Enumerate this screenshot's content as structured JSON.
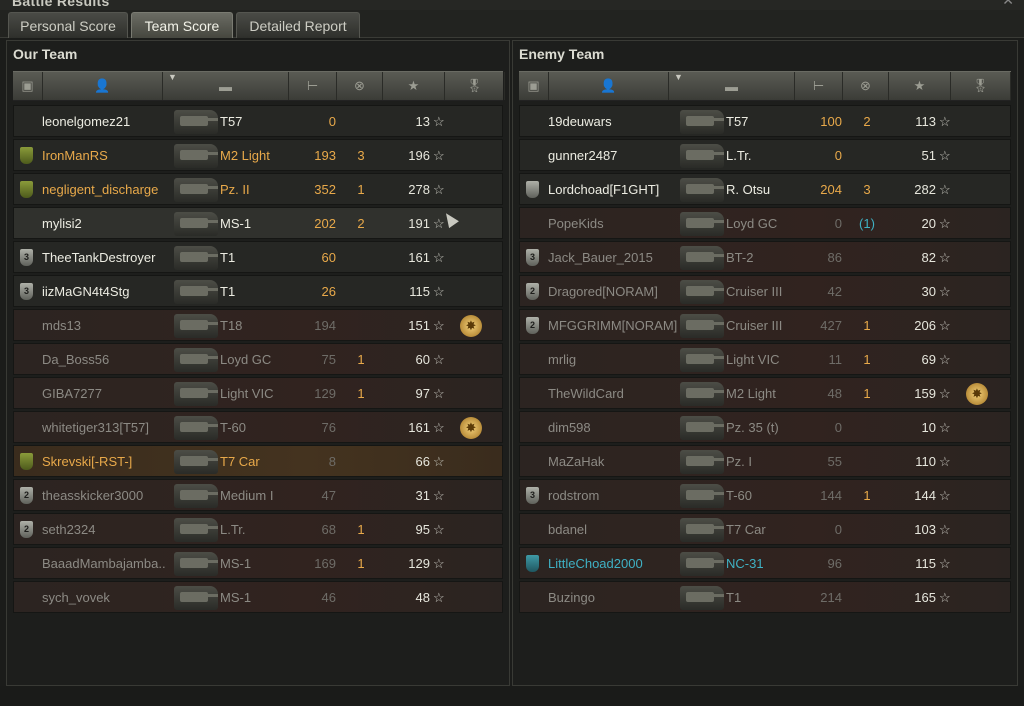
{
  "window": {
    "title": "Battle Results",
    "close_icon": "close-icon"
  },
  "tabs": [
    {
      "label": "Personal Score",
      "active": false
    },
    {
      "label": "Team Score",
      "active": true
    },
    {
      "label": "Detailed Report",
      "active": false
    }
  ],
  "columns": {
    "icons": [
      "platoon-icon",
      "player-icon",
      "tank-icon",
      "damage-icon",
      "kills-icon",
      "xp-icon",
      "medal-icon"
    ],
    "sort_icon": "sort-arrow-icon"
  },
  "our_team": {
    "title": "Our Team",
    "rows": [
      {
        "badge": "",
        "player": "leonelgomez21",
        "tank": "T57",
        "damage": "0",
        "kills": "",
        "xp": "13",
        "medal": false,
        "name_color": "white",
        "dmg_color": "orange",
        "state": "alive"
      },
      {
        "badge": "gold",
        "player": "IronManRS",
        "tank": "M2 Light",
        "damage": "193",
        "kills": "3",
        "xp": "196",
        "medal": false,
        "name_color": "orange",
        "dmg_color": "orange",
        "state": "alive"
      },
      {
        "badge": "gold",
        "player": "negligent_discharge",
        "tank": "Pz. II",
        "damage": "352",
        "kills": "1",
        "xp": "278",
        "medal": false,
        "name_color": "orange",
        "dmg_color": "orange",
        "state": "alive"
      },
      {
        "badge": "",
        "player": "mylisi2",
        "tank": "MS-1",
        "damage": "202",
        "kills": "2",
        "xp": "191",
        "medal": false,
        "name_color": "white",
        "dmg_color": "orange",
        "state": "hl"
      },
      {
        "badge": "3",
        "player": "TheeTankDestroyer",
        "tank": "T1",
        "damage": "60",
        "kills": "",
        "xp": "161",
        "medal": false,
        "name_color": "white",
        "dmg_color": "orange",
        "state": "alive"
      },
      {
        "badge": "3",
        "player": "iizMaGN4t4Stg",
        "tank": "T1",
        "damage": "26",
        "kills": "",
        "xp": "115",
        "medal": false,
        "name_color": "white",
        "dmg_color": "orange",
        "state": "alive"
      },
      {
        "badge": "",
        "player": "mds13",
        "tank": "T18",
        "damage": "194",
        "kills": "",
        "xp": "151",
        "medal": true,
        "name_color": "grey",
        "dmg_color": "grey",
        "state": "dead"
      },
      {
        "badge": "",
        "player": "Da_Boss56",
        "tank": "Loyd GC",
        "damage": "75",
        "kills": "1",
        "xp": "60",
        "medal": false,
        "name_color": "grey",
        "dmg_color": "grey",
        "state": "dead"
      },
      {
        "badge": "",
        "player": "GIBA7277",
        "tank": "Light VIC",
        "damage": "129",
        "kills": "1",
        "xp": "97",
        "medal": false,
        "name_color": "grey",
        "dmg_color": "grey",
        "state": "dead"
      },
      {
        "badge": "",
        "player": "whitetiger313[T57]",
        "tank": "T-60",
        "damage": "76",
        "kills": "",
        "xp": "161",
        "medal": true,
        "name_color": "grey",
        "dmg_color": "grey",
        "state": "dead"
      },
      {
        "badge": "gold",
        "player": "Skrevski[-RST-]",
        "tank": "T7 Car",
        "damage": "8",
        "kills": "",
        "xp": "66",
        "medal": false,
        "name_color": "orange",
        "dmg_color": "grey",
        "state": "plat"
      },
      {
        "badge": "2",
        "player": "theasskicker3000",
        "tank": "Medium I",
        "damage": "47",
        "kills": "",
        "xp": "31",
        "medal": false,
        "name_color": "grey",
        "dmg_color": "grey",
        "state": "dead"
      },
      {
        "badge": "2",
        "player": "seth2324",
        "tank": "L.Tr.",
        "damage": "68",
        "kills": "1",
        "xp": "95",
        "medal": false,
        "name_color": "grey",
        "dmg_color": "grey",
        "state": "dead"
      },
      {
        "badge": "",
        "player": "BaaadMambajamba..",
        "tank": "MS-1",
        "damage": "169",
        "kills": "1",
        "xp": "129",
        "medal": false,
        "name_color": "grey",
        "dmg_color": "grey",
        "state": "dead"
      },
      {
        "badge": "",
        "player": "sych_vovek",
        "tank": "MS-1",
        "damage": "46",
        "kills": "",
        "xp": "48",
        "medal": false,
        "name_color": "grey",
        "dmg_color": "grey",
        "state": "dead"
      }
    ]
  },
  "enemy_team": {
    "title": "Enemy Team",
    "rows": [
      {
        "badge": "",
        "player": "19deuwars",
        "tank": "T57",
        "damage": "100",
        "kills": "2",
        "xp": "113",
        "medal": false,
        "name_color": "white",
        "dmg_color": "orange",
        "state": "alive"
      },
      {
        "badge": "",
        "player": "gunner2487",
        "tank": "L.Tr.",
        "damage": "0",
        "kills": "",
        "xp": "51",
        "medal": false,
        "name_color": "white",
        "dmg_color": "orange",
        "state": "alive"
      },
      {
        "badge": "silver1",
        "player": "Lordchoad[F1GHT]",
        "tank": "R. Otsu",
        "damage": "204",
        "kills": "3",
        "xp": "282",
        "medal": false,
        "name_color": "white",
        "dmg_color": "orange",
        "state": "alive"
      },
      {
        "badge": "",
        "player": "PopeKids",
        "tank": "Loyd GC",
        "damage": "0",
        "kills": "(1)",
        "xp": "20",
        "medal": false,
        "name_color": "grey",
        "dmg_color": "grey",
        "state": "dead"
      },
      {
        "badge": "3",
        "player": "Jack_Bauer_2015",
        "tank": "BT-2",
        "damage": "86",
        "kills": "",
        "xp": "82",
        "medal": false,
        "name_color": "grey",
        "dmg_color": "grey",
        "state": "dead"
      },
      {
        "badge": "2",
        "player": "Dragored[NORAM]",
        "tank": "Cruiser III",
        "damage": "42",
        "kills": "",
        "xp": "30",
        "medal": false,
        "name_color": "grey",
        "dmg_color": "grey",
        "state": "dead"
      },
      {
        "badge": "2",
        "player": "MFGGRIMM[NORAM]",
        "tank": "Cruiser III",
        "damage": "427",
        "kills": "1",
        "xp": "206",
        "medal": false,
        "name_color": "grey",
        "dmg_color": "grey",
        "state": "dead"
      },
      {
        "badge": "",
        "player": "mrlig",
        "tank": "Light VIC",
        "damage": "11",
        "kills": "1",
        "xp": "69",
        "medal": false,
        "name_color": "grey",
        "dmg_color": "grey",
        "state": "dead"
      },
      {
        "badge": "",
        "player": "TheWildCard",
        "tank": "M2 Light",
        "damage": "48",
        "kills": "1",
        "xp": "159",
        "medal": true,
        "name_color": "grey",
        "dmg_color": "grey",
        "state": "dead"
      },
      {
        "badge": "",
        "player": "dim598",
        "tank": "Pz. 35 (t)",
        "damage": "0",
        "kills": "",
        "xp": "10",
        "medal": false,
        "name_color": "grey",
        "dmg_color": "grey",
        "state": "dead"
      },
      {
        "badge": "",
        "player": "MaZaHak",
        "tank": "Pz. I",
        "damage": "55",
        "kills": "",
        "xp": "110",
        "medal": false,
        "name_color": "grey",
        "dmg_color": "grey",
        "state": "dead"
      },
      {
        "badge": "3",
        "player": "rodstrom",
        "tank": "T-60",
        "damage": "144",
        "kills": "1",
        "xp": "144",
        "medal": false,
        "name_color": "grey",
        "dmg_color": "grey",
        "state": "dead"
      },
      {
        "badge": "",
        "player": "bdanel",
        "tank": "T7 Car",
        "damage": "0",
        "kills": "",
        "xp": "103",
        "medal": false,
        "name_color": "grey",
        "dmg_color": "grey",
        "state": "dead"
      },
      {
        "badge": "blue",
        "player": "LittleChoad2000",
        "tank": "NC-31",
        "damage": "96",
        "kills": "",
        "xp": "115",
        "medal": false,
        "name_color": "cyan",
        "dmg_color": "grey",
        "state": "dead"
      },
      {
        "badge": "",
        "player": "Buzingo",
        "tank": "T1",
        "damage": "214",
        "kills": "",
        "xp": "165",
        "medal": false,
        "name_color": "grey",
        "dmg_color": "grey",
        "state": "dead"
      }
    ]
  },
  "star_glyph": "☆"
}
